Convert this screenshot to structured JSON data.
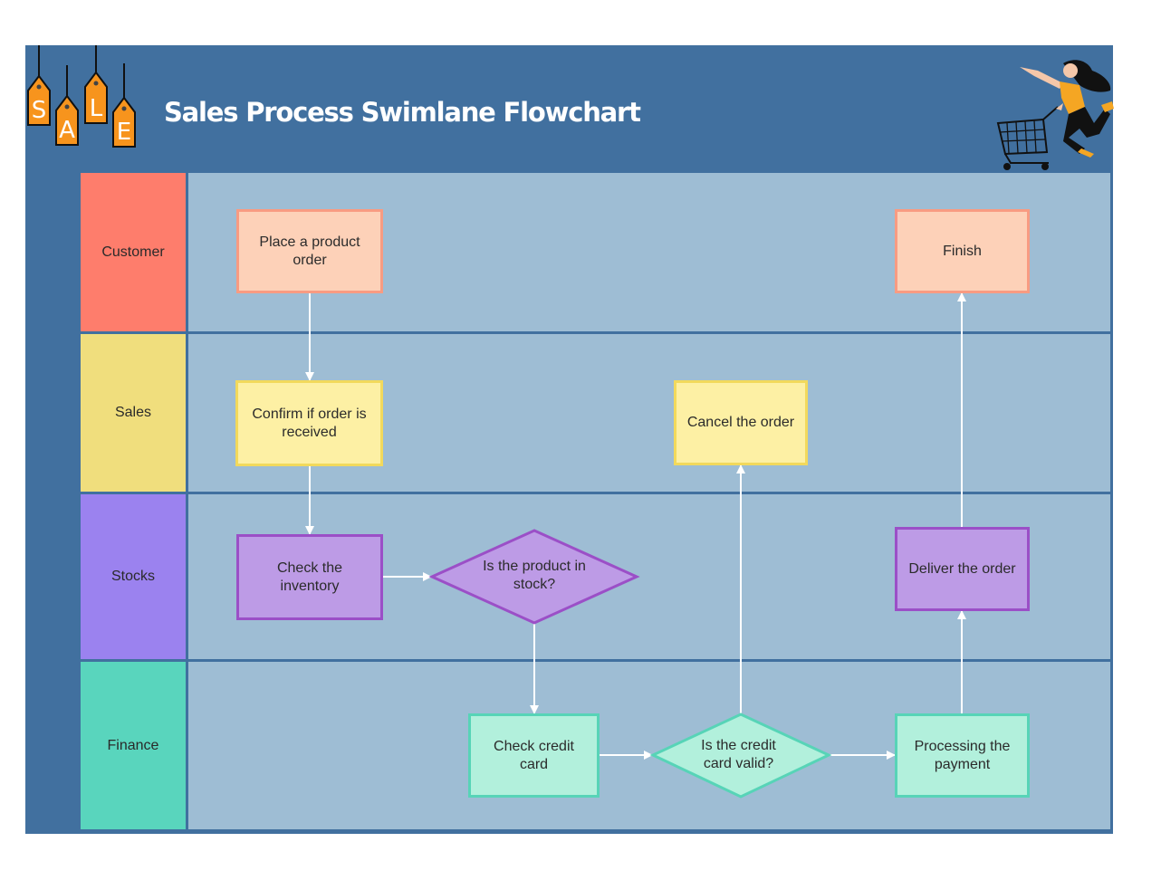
{
  "title": "Sales Process Swimlane Flowchart",
  "decorations": {
    "sale_tags": [
      "S",
      "A",
      "L",
      "E"
    ],
    "illustration": "woman-pushing-shopping-cart"
  },
  "colors": {
    "frame": "#41709f",
    "lane_body": "#9ebdd4",
    "connector": "#ffffff",
    "customer": "#fe7d6c",
    "sales": "#f0de7d",
    "stocks": "#9b82ef",
    "finance": "#59d5bd"
  },
  "lanes": [
    {
      "id": "customer",
      "label": "Customer"
    },
    {
      "id": "sales",
      "label": "Sales"
    },
    {
      "id": "stocks",
      "label": "Stocks"
    },
    {
      "id": "finance",
      "label": "Finance"
    }
  ],
  "nodes": {
    "place_order": {
      "lane": "customer",
      "type": "process",
      "label": "Place a product order"
    },
    "finish": {
      "lane": "customer",
      "type": "process",
      "label": "Finish"
    },
    "confirm_order": {
      "lane": "sales",
      "type": "process",
      "label": "Confirm if order is received"
    },
    "cancel_order": {
      "lane": "sales",
      "type": "process",
      "label": "Cancel the order"
    },
    "check_inventory": {
      "lane": "stocks",
      "type": "process",
      "label": "Check the inventory"
    },
    "in_stock": {
      "lane": "stocks",
      "type": "decision",
      "label": "Is the product in stock?"
    },
    "deliver_order": {
      "lane": "stocks",
      "type": "process",
      "label": "Deliver the order"
    },
    "check_card": {
      "lane": "finance",
      "type": "process",
      "label": "Check credit card"
    },
    "card_valid": {
      "lane": "finance",
      "type": "decision",
      "label": "Is the credit card valid?"
    },
    "process_payment": {
      "lane": "finance",
      "type": "process",
      "label": "Processing the payment"
    }
  },
  "edges": [
    {
      "from": "place_order",
      "to": "confirm_order"
    },
    {
      "from": "confirm_order",
      "to": "check_inventory"
    },
    {
      "from": "check_inventory",
      "to": "in_stock"
    },
    {
      "from": "in_stock",
      "to": "check_card"
    },
    {
      "from": "check_card",
      "to": "card_valid"
    },
    {
      "from": "card_valid",
      "to": "cancel_order"
    },
    {
      "from": "card_valid",
      "to": "process_payment"
    },
    {
      "from": "process_payment",
      "to": "deliver_order"
    },
    {
      "from": "deliver_order",
      "to": "finish"
    }
  ]
}
